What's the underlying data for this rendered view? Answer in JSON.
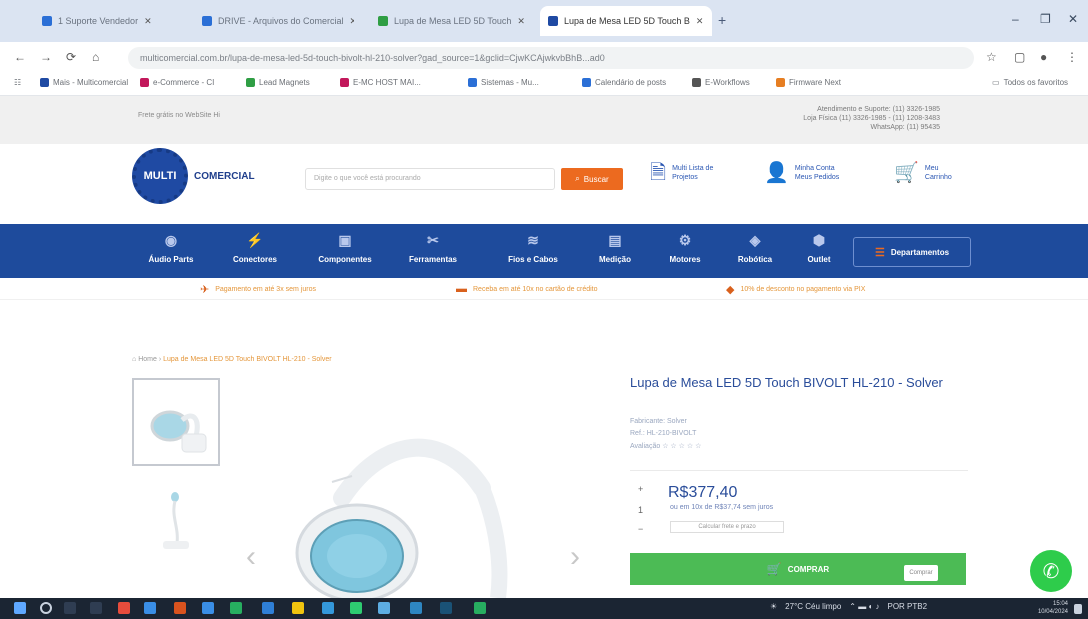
{
  "browser": {
    "tabs": [
      {
        "label": "1 Suporte Vendedor",
        "color": "#2b6fd6"
      },
      {
        "label": "DRIVE - Arquivos do Comercial",
        "color": "#2b6fd6"
      },
      {
        "label": "Lupa de Mesa LED 5D Touch",
        "color": "#2f9e44"
      },
      {
        "label": "Lupa de Mesa LED 5D Touch B",
        "color": "#1f4aa3"
      }
    ],
    "new_tab": "+",
    "window_controls": [
      "–",
      "❐",
      "✕"
    ],
    "nav": {
      "back": "←",
      "forward": "→",
      "reload": "⟳",
      "home": "⌂"
    },
    "url": "multicomercial.com.br/lupa-de-mesa-led-5d-touch-bivolt-hl-210-solver?gad_source=1&gclid=CjwKCAjwkvbBhB...ad0",
    "bookmarks": [
      {
        "label": "Mais - Multicomercial",
        "color": "#1f4aa3"
      },
      {
        "label": "e-Commerce - CI",
        "color": "#c2185b"
      },
      {
        "label": "Lead Magnets",
        "color": "#2f9e44"
      },
      {
        "label": "E-MC HOST MAI...",
        "color": "#c2185b"
      },
      {
        "label": "Sistemas - Mu...",
        "color": "#2b6fd6"
      },
      {
        "label": "Calendário de posts",
        "color": "#2b6fd6"
      },
      {
        "label": "E-Workflows",
        "color": "#555555"
      },
      {
        "label": "Firmware Next",
        "color": "#e67e22"
      }
    ],
    "bookmarks_more": "Todos os favoritos"
  },
  "site": {
    "top_left": "Frete grátis no WebSite Hi",
    "top_right": [
      "Atendimento e Suporte: (11) 3326-1985",
      "Loja Física (11) 3326-1985 - (11) 1208-3483",
      "WhatsApp: (11) 95435"
    ],
    "logo": {
      "mark": "MULTI",
      "text": "COMERCIAL"
    },
    "search_placeholder": "Digite o que você está procurando",
    "search_button": "Buscar",
    "header_links": [
      {
        "icon": "document-icon",
        "glyph": "🗎",
        "line1": "Multi Lista de",
        "line2": "Projetos"
      },
      {
        "icon": "user-icon",
        "glyph": "👤",
        "line1": "Minha Conta",
        "line2": "Meus Pedidos"
      },
      {
        "icon": "cart-icon",
        "glyph": "🛒",
        "line1": "Meu",
        "line2": "Carrinho"
      }
    ],
    "categories": [
      {
        "label": "Áudio Parts",
        "glyph": "◉"
      },
      {
        "label": "Conectores",
        "glyph": "⚡"
      },
      {
        "label": "Componentes",
        "glyph": "▣"
      },
      {
        "label": "Ferramentas",
        "glyph": "✂"
      },
      {
        "label": "Fios e Cabos",
        "glyph": "≋"
      },
      {
        "label": "Medição",
        "glyph": "▤"
      },
      {
        "label": "Motores",
        "glyph": "⚙"
      },
      {
        "label": "Robótica",
        "glyph": "◈"
      },
      {
        "label": "Outlet",
        "glyph": "⬢"
      }
    ],
    "departments_label": "Departamentos",
    "promos": [
      "Pagamento em até 3x sem juros",
      "Receba em até 10x no cartão de crédito",
      "10% de desconto no pagamento via PIX"
    ],
    "breadcrumb": {
      "home": "Home",
      "path": "Lupa de Mesa LED 5D Touch BIVOLT HL-210 - Solver"
    }
  },
  "product": {
    "title": "Lupa de Mesa LED 5D Touch BIVOLT HL-210 - Solver",
    "brand": "Fabricante: Solver",
    "sku": "Ref.: HL-210-BIVOLT",
    "rating_label": "Avaliação",
    "rating_stars": 0,
    "price": "R$377,40",
    "installments": "ou em 10x de R$37,74 sem juros",
    "shipping_link": "Calcular frete e prazo",
    "buy_label": "COMPRAR",
    "buy_badge": "Comprar",
    "prev_arrow": "‹",
    "next_arrow": "›",
    "qty_plus": "+",
    "qty_value": "1",
    "qty_minus": "−"
  },
  "taskbar": {
    "tray_weather": "27°C Céu limpo",
    "tray_lang": "POR PTB2",
    "clock_time": "15:04",
    "clock_date": "10/04/2024"
  }
}
